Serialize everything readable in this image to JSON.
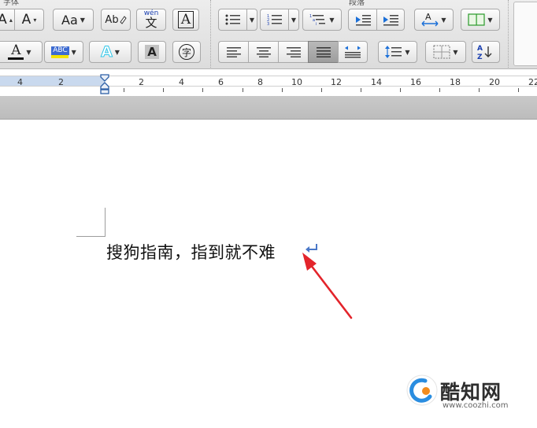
{
  "ribbon": {
    "font_group_label": "字体",
    "paragraph_group_label": "段落",
    "font_size_up": "A",
    "font_size_down": "A",
    "change_case": "Aa",
    "spell_check": "Ab",
    "phonetic_top": "wén",
    "phonetic_bottom": "文",
    "char_border": "A",
    "font_color": "A",
    "highlight": "ABC",
    "text_effects": "A",
    "char_shading": "A",
    "enclosed_char": "字",
    "sort_icon_label": "A↓Z"
  },
  "colors": {
    "font_color_underline": "#111111",
    "highlight_yellow": "#f4e400",
    "highlight_blue": "#3d6bd1",
    "text_effect_cyan": "#2ec6e8",
    "arrow_red": "#e3242b",
    "paragraph_mark_blue": "#4a78c8",
    "ruler_margin": "#c9d9ee"
  },
  "ruler": {
    "labels": [
      "4",
      "2",
      "2",
      "4",
      "6",
      "8",
      "10",
      "12",
      "14",
      "16",
      "18",
      "20",
      "22"
    ]
  },
  "document": {
    "text": "搜狗指南，指到就不难"
  },
  "watermark": {
    "title": "酷知网",
    "url": "www.coozhi.com"
  }
}
